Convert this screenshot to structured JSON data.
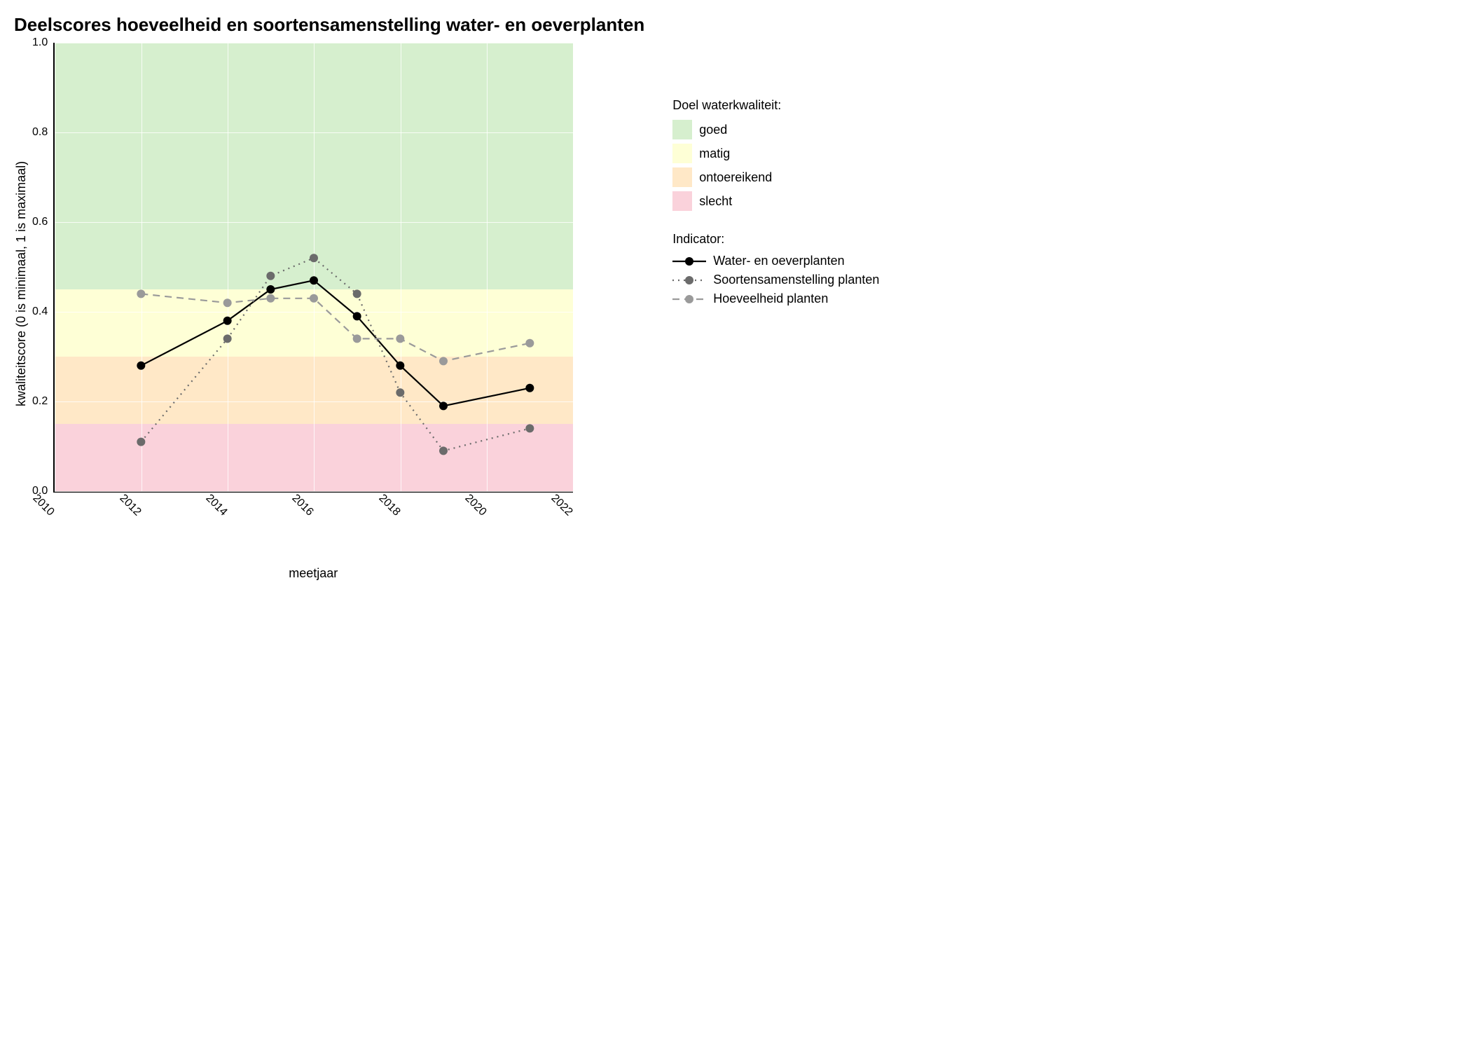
{
  "chart_data": {
    "type": "line",
    "title": "Deelscores hoeveelheid en soortensamenstelling water- en oeverplanten",
    "xlabel": "meetjaar",
    "ylabel": "kwaliteitscore (0 is minimaal, 1 is maximaal)",
    "xlim": [
      2010,
      2022
    ],
    "ylim": [
      0,
      1
    ],
    "x_ticks": [
      2010,
      2012,
      2014,
      2016,
      2018,
      2020,
      2022
    ],
    "y_ticks": [
      0.0,
      0.2,
      0.4,
      0.6,
      0.8,
      1.0
    ],
    "bands": [
      {
        "name": "goed",
        "from": 0.45,
        "to": 1.0,
        "color": "#d6efce"
      },
      {
        "name": "matig",
        "from": 0.3,
        "to": 0.45,
        "color": "#feffd6"
      },
      {
        "name": "ontoereikend",
        "from": 0.15,
        "to": 0.3,
        "color": "#ffe8c7"
      },
      {
        "name": "slecht",
        "from": 0.0,
        "to": 0.15,
        "color": "#fad2db"
      }
    ],
    "series": [
      {
        "name": "Water- en oeverplanten",
        "color": "#000000",
        "dash": "solid",
        "marker_color": "#000000",
        "x": [
          2012,
          2014,
          2015,
          2016,
          2017,
          2018,
          2019,
          2021
        ],
        "y": [
          0.28,
          0.38,
          0.45,
          0.47,
          0.39,
          0.28,
          0.19,
          0.23
        ]
      },
      {
        "name": "Soortensamenstelling planten",
        "color": "#6b6b6b",
        "dash": "dotted",
        "marker_color": "#6b6b6b",
        "x": [
          2012,
          2014,
          2015,
          2016,
          2017,
          2018,
          2019,
          2021
        ],
        "y": [
          0.11,
          0.34,
          0.48,
          0.52,
          0.44,
          0.22,
          0.09,
          0.14
        ]
      },
      {
        "name": "Hoeveelheid planten",
        "color": "#9a9a9a",
        "dash": "dashed",
        "marker_color": "#9a9a9a",
        "x": [
          2012,
          2014,
          2015,
          2016,
          2017,
          2018,
          2019,
          2021
        ],
        "y": [
          0.44,
          0.42,
          0.43,
          0.43,
          0.34,
          0.34,
          0.29,
          0.33
        ]
      }
    ],
    "legend_band_title": "Doel waterkwaliteit:",
    "legend_series_title": "Indicator:"
  }
}
